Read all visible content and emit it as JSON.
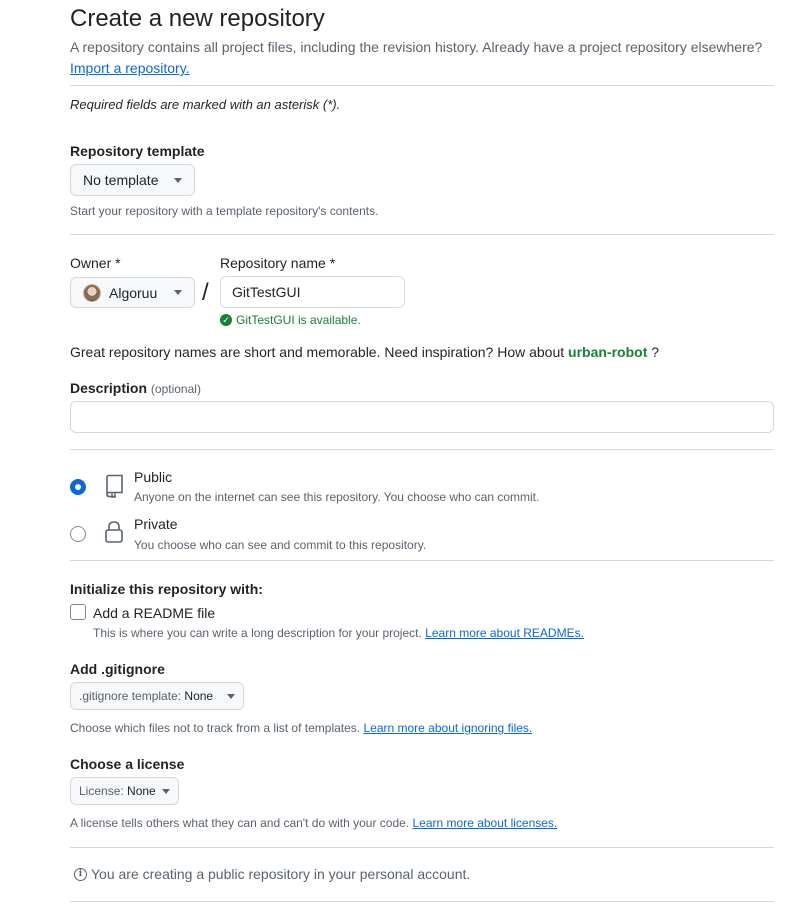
{
  "header": {
    "title": "Create a new repository",
    "subtitle": "A repository contains all project files, including the revision history. Already have a project repository elsewhere?",
    "import_link": "Import a repository."
  },
  "required_note": "Required fields are marked with an asterisk (*).",
  "template": {
    "label": "Repository template",
    "selected": "No template",
    "hint": "Start your repository with a template repository's contents."
  },
  "owner": {
    "label": "Owner *",
    "selected": "Algoruu"
  },
  "separator": "/",
  "repo_name": {
    "label": "Repository name *",
    "value": "GitTestGUI",
    "availability": "GitTestGUI is available."
  },
  "inspiration": {
    "text": "Great repository names are short and memorable. Need inspiration? How about",
    "suggestion": "urban-robot",
    "suffix": "?"
  },
  "description": {
    "label": "Description",
    "optional": "(optional)",
    "value": ""
  },
  "visibility": {
    "selected": "public",
    "public": {
      "title": "Public",
      "description": "Anyone on the internet can see this repository. You choose who can commit.",
      "icon": "repo-icon"
    },
    "private": {
      "title": "Private",
      "description": "You choose who can see and commit to this repository.",
      "icon": "lock-icon"
    }
  },
  "initialize": {
    "heading": "Initialize this repository with:",
    "readme_label": "Add a README file",
    "readme_checked": false,
    "readme_hint": "This is where you can write a long description for your project.",
    "readme_link": "Learn more about READMEs."
  },
  "gitignore": {
    "label": "Add .gitignore",
    "button_prefix": ".gitignore template:",
    "button_value": "None",
    "hint": "Choose which files not to track from a list of templates.",
    "link": "Learn more about ignoring files."
  },
  "license": {
    "label": "Choose a license",
    "button_prefix": "License:",
    "button_value": "None",
    "hint": "A license tells others what they can and can't do with your code.",
    "link": "Learn more about licenses."
  },
  "info": {
    "text": "You are creating a public repository in your personal account."
  },
  "colors": {
    "accent": "#0969da",
    "success": "#1a7f37",
    "muted": "#59636e",
    "border": "#d1d9e0"
  }
}
